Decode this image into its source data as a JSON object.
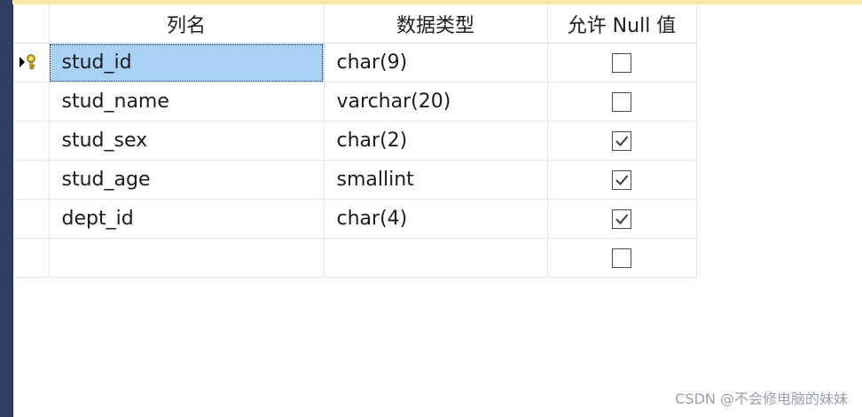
{
  "columns_header": {
    "name": "列名",
    "type": "数据类型",
    "nullable": "允许 Null 值"
  },
  "rows": [
    {
      "name": "stud_id",
      "type": "char(9)",
      "nullable": false,
      "primary_key": true,
      "selected": true
    },
    {
      "name": "stud_name",
      "type": "varchar(20)",
      "nullable": false
    },
    {
      "name": "stud_sex",
      "type": "char(2)",
      "nullable": true
    },
    {
      "name": "stud_age",
      "type": "smallint",
      "nullable": true
    },
    {
      "name": "dept_id",
      "type": "char(4)",
      "nullable": true
    },
    {
      "name": "",
      "type": "",
      "nullable": false
    }
  ],
  "icons": {
    "row_indicator": "current-row-arrow-icon",
    "primary_key": "key-icon",
    "checkbox_checked": "checkmark-icon"
  },
  "colors": {
    "selection": "#a9d1f5",
    "left_bar": "#2e3e63",
    "top_strip": "#f9e7a7",
    "key": "#e8c21a"
  },
  "watermark": "CSDN @不会修电脑的妹妹"
}
